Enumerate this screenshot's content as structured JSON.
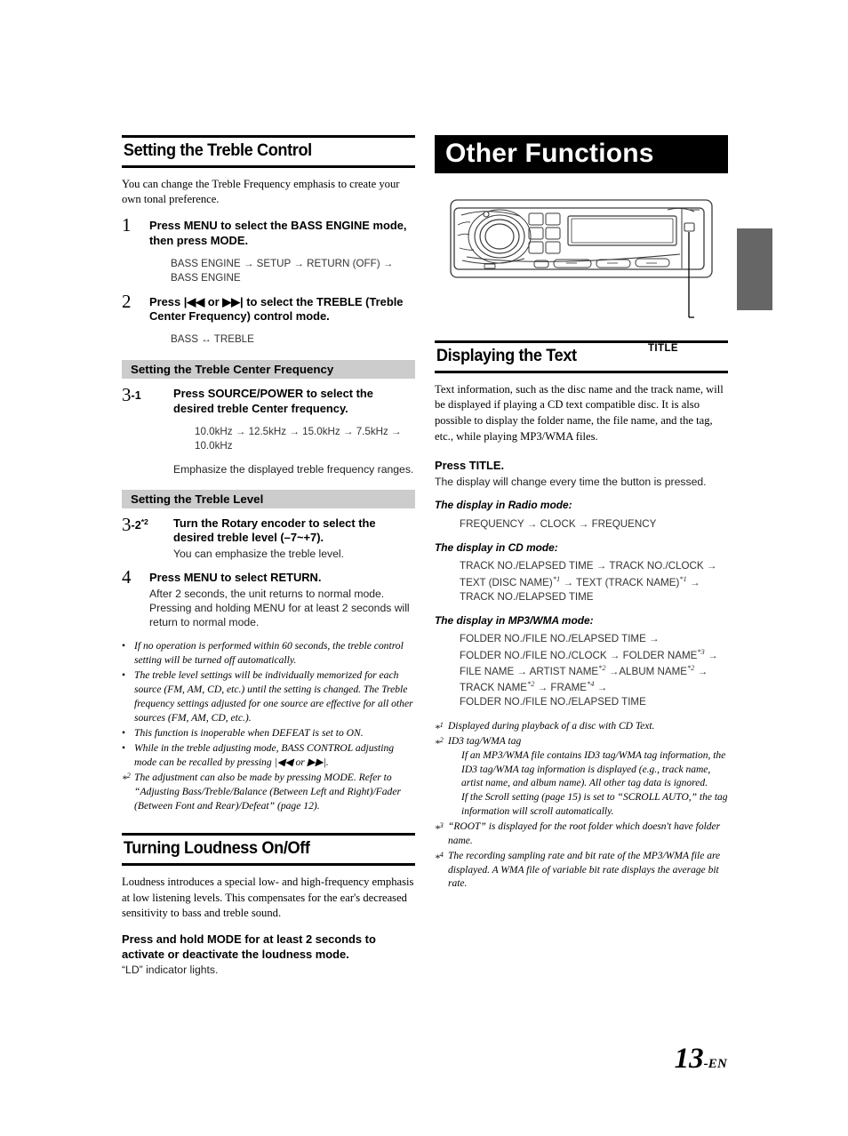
{
  "page": {
    "number": "13",
    "suffix": "-EN"
  },
  "left": {
    "heading": "Setting the Treble Control",
    "intro": "You can change the Treble Frequency emphasis to create your own tonal preference.",
    "steps": [
      {
        "num": "1",
        "title": "Press MENU to select the BASS ENGINE mode, then press MODE.",
        "flow": "BASS ENGINE → SETUP → RETURN (OFF) → BASS ENGINE"
      },
      {
        "num": "2",
        "title": "Press |◀◀ or ▶▶| to select the TREBLE (Treble Center Frequency) control mode.",
        "flow": "BASS ↔ TREBLE"
      }
    ],
    "subsection_freq": {
      "bar": "Setting the Treble Center Frequency",
      "num": "3",
      "num_suffix": "-1",
      "title": "Press SOURCE/POWER to select the desired treble Center frequency.",
      "flow": "10.0kHz → 12.5kHz → 15.0kHz → 7.5kHz → 10.0kHz",
      "note": "Emphasize the displayed treble frequency ranges."
    },
    "subsection_level": {
      "bar": "Setting the Treble Level",
      "num": "3",
      "num_suffix": "-2",
      "num_sup": "*2",
      "title": "Turn the Rotary encoder to select the desired treble level (–7~+7).",
      "note": "You can emphasize the treble level."
    },
    "step4": {
      "num": "4",
      "title": "Press MENU to select RETURN.",
      "note": "After 2 seconds, the unit returns to normal mode. Pressing and holding MENU for at least 2 seconds will return to normal mode."
    },
    "notes": [
      {
        "mark": "•",
        "text": "If no operation is performed within 60 seconds, the treble control setting will be turned off automatically."
      },
      {
        "mark": "•",
        "text": "The treble level settings will be individually memorized for each source (FM, AM, CD, etc.) until the setting is changed. The Treble frequency settings adjusted for one source are effective for all other sources (FM, AM, CD, etc.)."
      },
      {
        "mark": "•",
        "text": "This function is inoperable when DEFEAT is set to ON."
      },
      {
        "mark": "•",
        "text": "While in the treble adjusting mode, BASS CONTROL adjusting mode can be recalled by pressing |◀◀ or ▶▶|."
      },
      {
        "mark": "*2",
        "text": "The adjustment can also be made by pressing MODE. Refer to “Adjusting Bass/Treble/Balance (Between Left and Right)/Fader (Between Font and Rear)/Defeat” (page 12)."
      }
    ],
    "loudness": {
      "heading": "Turning Loudness On/Off",
      "intro": "Loudness introduces a special low- and high-frequency emphasis at low listening levels. This compensates for the ear's decreased sensitivity to bass and treble sound.",
      "lead": "Press and hold MODE for at least 2 seconds to activate or deactivate the loudness mode.",
      "note": "“LD” indicator lights."
    }
  },
  "right": {
    "banner": "Other Functions",
    "device_callout": "TITLE",
    "heading": "Displaying the Text",
    "intro": "Text information, such as the disc name and the track name, will be displayed if playing a CD text compatible disc. It is also possible to display the folder name, the file name, and the tag, etc., while playing MP3/WMA files.",
    "lead": "Press TITLE.",
    "lead_note": "The display will change every time the button is pressed.",
    "modes": [
      {
        "label": "The display in Radio mode:",
        "lines": [
          "FREQUENCY → CLOCK → FREQUENCY"
        ]
      },
      {
        "label": "The display in CD mode:",
        "lines": [
          "TRACK NO./ELAPSED TIME → TRACK NO./CLOCK →",
          "TEXT (DISC NAME)*1 → TEXT (TRACK NAME)*1 →",
          "TRACK NO./ELAPSED TIME"
        ]
      },
      {
        "label": "The display in MP3/WMA mode:",
        "lines": [
          "FOLDER NO./FILE NO./ELAPSED TIME →",
          "FOLDER NO./FILE NO./CLOCK → FOLDER NAME*3 →",
          "FILE NAME → ARTIST NAME*2 →ALBUM NAME*2 →",
          "TRACK NAME*2 → FRAME*4 →",
          "FOLDER NO./FILE NO./ELAPSED TIME"
        ]
      }
    ],
    "footnotes": [
      {
        "mark": "*1",
        "lines": [
          "Displayed during playback of a disc with CD Text."
        ]
      },
      {
        "mark": "*2",
        "lines": [
          "ID3 tag/WMA tag",
          "If an MP3/WMA file contains ID3 tag/WMA tag information, the ID3 tag/WMA tag information is displayed (e.g., track name, artist name, and album name). All other tag data is ignored.",
          "If the Scroll setting (page 15) is set to “SCROLL AUTO,” the tag information will scroll automatically."
        ]
      },
      {
        "mark": "*3",
        "lines": [
          "“ROOT” is displayed for the root folder which doesn't have folder name."
        ]
      },
      {
        "mark": "*4",
        "lines": [
          "The recording sampling rate and bit rate of the MP3/WMA file are displayed. A WMA file of variable bit rate displays the average bit rate."
        ]
      }
    ]
  }
}
